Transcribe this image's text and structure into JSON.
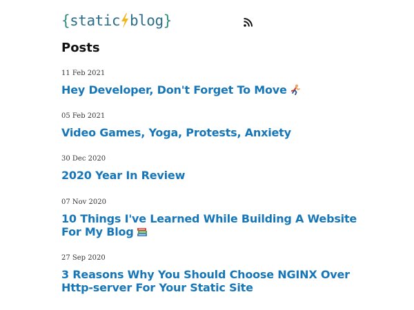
{
  "site": {
    "logo_open": "{",
    "logo_word1": "static",
    "logo_word2": "blog",
    "logo_close": "}",
    "rss_icon": "rss-icon",
    "accent_color": "#1676b8"
  },
  "page_title": "Posts",
  "posts": [
    {
      "date": "11 Feb 2021",
      "title": "Hey Developer, Don't Forget To Move",
      "emoji": "runner-emoji"
    },
    {
      "date": "05 Feb 2021",
      "title": "Video Games, Yoga, Protests, Anxiety"
    },
    {
      "date": "30 Dec 2020",
      "title": "2020 Year In Review"
    },
    {
      "date": "07 Nov 2020",
      "title": "10 Things I've Learned While Building A Website For My Blog",
      "emoji": "books-emoji"
    },
    {
      "date": "27 Sep 2020",
      "title": "3 Reasons Why You Should Choose NGINX Over Http-server For Your Static Site"
    }
  ]
}
